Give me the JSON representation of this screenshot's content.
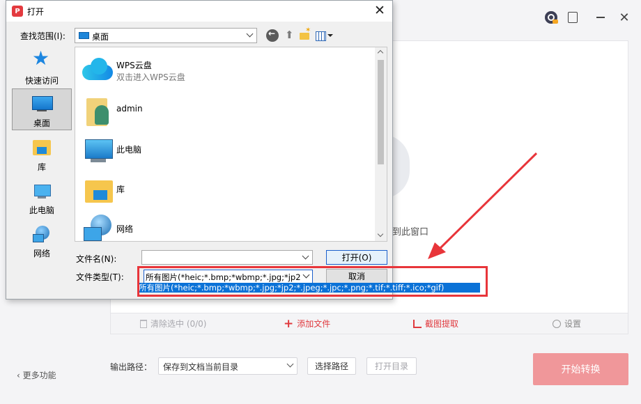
{
  "app": {
    "drop_hint": "到此窗口",
    "actions": {
      "clear_selected": "清除选中 (0/0)",
      "add_file": "添加文件",
      "crop_extract": "截图提取",
      "settings": "设置"
    },
    "more_features": "更多功能",
    "output_label": "输出路径：",
    "output_value": "保存到文档当前目录",
    "choose_path": "选择路径",
    "open_dir": "打开目录",
    "start_convert": "开始转换"
  },
  "dialog": {
    "title": "打开",
    "lookin_label": "查找范围(I):",
    "lookin_value": "桌面",
    "places": [
      {
        "label": "快速访问",
        "icon": "quick-access-star-icon"
      },
      {
        "label": "桌面",
        "icon": "desktop-icon"
      },
      {
        "label": "库",
        "icon": "library-icon"
      },
      {
        "label": "此电脑",
        "icon": "computer-icon"
      },
      {
        "label": "网络",
        "icon": "network-icon"
      }
    ],
    "items": [
      {
        "name": "WPS云盘",
        "sub": "双击进入WPS云盘",
        "icon": "wps-cloud-icon"
      },
      {
        "name": "admin",
        "icon": "user-folder-icon"
      },
      {
        "name": "此电脑",
        "icon": "computer-icon"
      },
      {
        "name": "库",
        "icon": "library-icon"
      },
      {
        "name": "网络",
        "icon": "network-icon"
      }
    ],
    "filename_label": "文件名(N):",
    "filename_value": "",
    "filetype_label": "文件类型(T):",
    "filetype_value": "所有图片(*heic;*.bmp;*wbmp;*.jpg;*jp2",
    "filetype_option": "所有图片(*heic;*.bmp;*wbmp;*.jpg;*jp2;*.jpeg;*.jpc;*.png;*.tif;*.tiff;*.ico;*gif)",
    "open_label": "打开(O)",
    "cancel_label": "取消"
  },
  "colors": {
    "accent": "#e0393e",
    "start_button": "#f0979a",
    "selection": "#0b72d7",
    "annotation": "#e8353a"
  }
}
